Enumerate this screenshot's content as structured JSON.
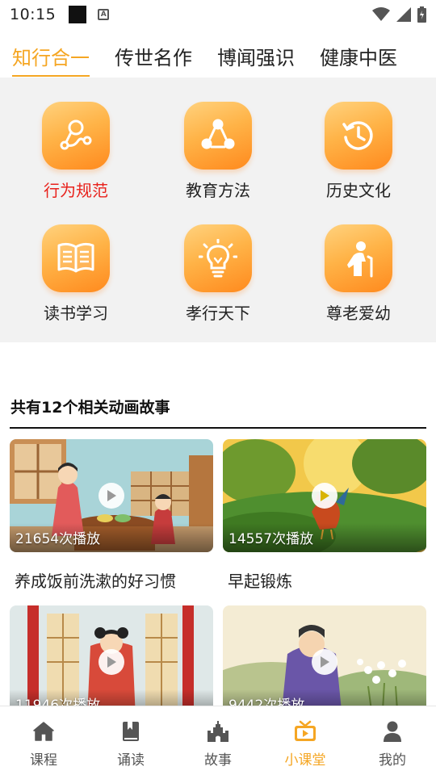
{
  "status_bar": {
    "time": "10:15",
    "icon_a_label": "A"
  },
  "top_tabs": [
    {
      "label": "知行合一",
      "active": true
    },
    {
      "label": "传世名作",
      "active": false
    },
    {
      "label": "博闻强识",
      "active": false
    },
    {
      "label": "健康中医",
      "active": false
    }
  ],
  "categories": [
    {
      "label": "行为规范",
      "icon": "network-icon",
      "active": true
    },
    {
      "label": "教育方法",
      "icon": "share-icon",
      "active": false
    },
    {
      "label": "历史文化",
      "icon": "history-clock-icon",
      "active": false
    },
    {
      "label": "读书学习",
      "icon": "open-book-icon",
      "active": false
    },
    {
      "label": "孝行天下",
      "icon": "lightbulb-icon",
      "active": false
    },
    {
      "label": "尊老爱幼",
      "icon": "elderly-person-icon",
      "active": false
    }
  ],
  "section": {
    "title": "共有12个相关动画故事"
  },
  "videos": [
    {
      "title": "养成饭前洗漱的好习惯",
      "plays": "21654次播放"
    },
    {
      "title": "早起锻炼",
      "plays": "14557次播放"
    },
    {
      "title": "",
      "plays": "11946次播放"
    },
    {
      "title": "",
      "plays": "9442次播放"
    }
  ],
  "bottom_nav": [
    {
      "label": "课程",
      "icon": "home-icon",
      "active": false
    },
    {
      "label": "诵读",
      "icon": "book-icon",
      "active": false
    },
    {
      "label": "故事",
      "icon": "castle-icon",
      "active": false
    },
    {
      "label": "小课堂",
      "icon": "tv-play-icon",
      "active": true
    },
    {
      "label": "我的",
      "icon": "person-icon",
      "active": false
    }
  ],
  "colors": {
    "accent": "#F5A623",
    "active_category": "#E8221C",
    "panel_bg": "#f2f2f2"
  }
}
